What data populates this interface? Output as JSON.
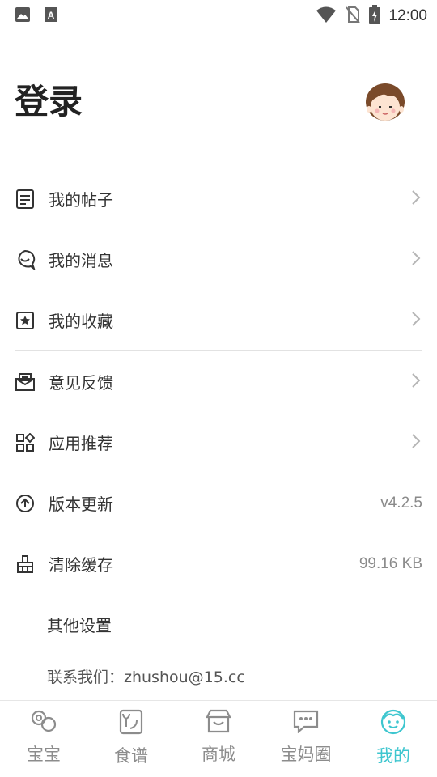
{
  "status_bar": {
    "time": "12:00",
    "icons": [
      "image-icon",
      "a-icon",
      "wifi-icon",
      "no-sim-icon",
      "battery-charging-icon"
    ]
  },
  "header": {
    "title": "登录",
    "avatar": "girl-avatar-icon"
  },
  "menu": {
    "items": [
      {
        "label": "我的帖子",
        "icon": "document-icon"
      },
      {
        "label": "我的消息",
        "icon": "message-bubble-icon"
      },
      {
        "label": "我的收藏",
        "icon": "star-box-icon"
      },
      {
        "label": "意见反馈",
        "icon": "mail-icon"
      },
      {
        "label": "应用推荐",
        "icon": "apps-icon"
      },
      {
        "label": "版本更新",
        "icon": "upgrade-icon",
        "value": "v4.2.5"
      },
      {
        "label": "清除缓存",
        "icon": "broom-icon",
        "value": "99.16 KB"
      },
      {
        "label": "其他设置"
      }
    ],
    "contact": "联系我们：zhushou@15.cc"
  },
  "tabs": [
    {
      "label": "宝宝",
      "icon": "baby-icon"
    },
    {
      "label": "食谱",
      "icon": "recipe-icon"
    },
    {
      "label": "商城",
      "icon": "store-icon"
    },
    {
      "label": "宝妈圈",
      "icon": "chat-icon"
    },
    {
      "label": "我的",
      "icon": "face-icon",
      "active": true
    }
  ],
  "colors": {
    "accent": "#3ec6cf",
    "text": "#333333",
    "muted": "#8c8c8c"
  }
}
